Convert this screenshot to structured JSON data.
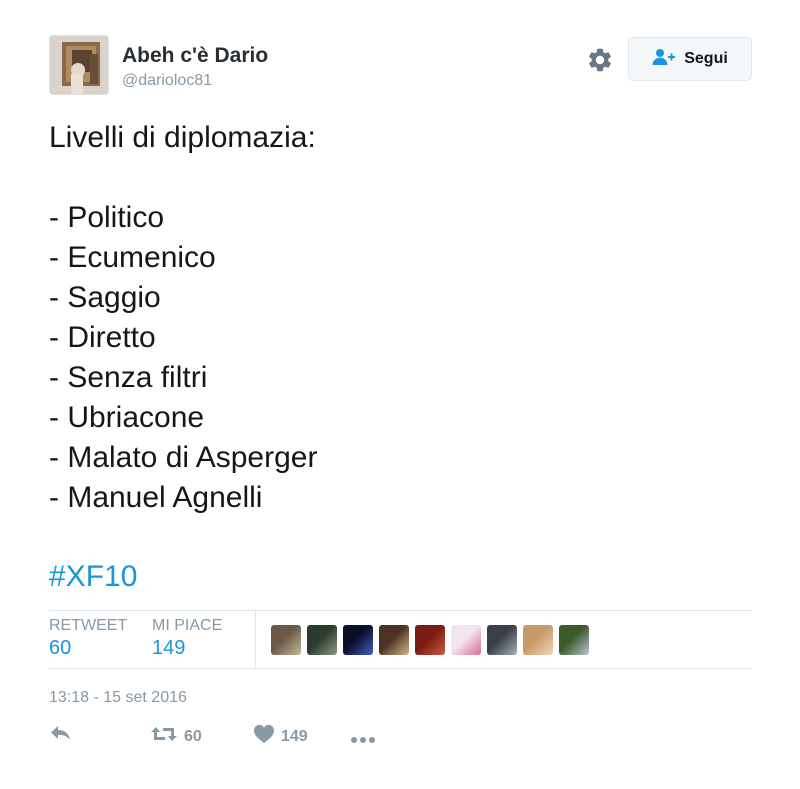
{
  "user": {
    "name": "Abeh c'è Dario",
    "handle": "@darioloc81"
  },
  "header": {
    "follow_label": "Segui"
  },
  "tweet": {
    "heading": "Livelli di diplomazia:",
    "items": [
      "- Politico",
      "- Ecumenico",
      "- Saggio",
      "- Diretto",
      "- Senza filtri",
      "- Ubriacone",
      "- Malato di Asperger",
      "- Manuel Agnelli"
    ],
    "hashtag": "#XF10"
  },
  "stats": {
    "retweet_label": "RETWEET",
    "retweet_count": "60",
    "like_label": "MI PIACE",
    "like_count": "149"
  },
  "likers": [
    {
      "colors": [
        "#6b5a4a",
        "#c9b89e"
      ]
    },
    {
      "colors": [
        "#2d3a2e",
        "#8a9a7e"
      ]
    },
    {
      "colors": [
        "#0b0f2a",
        "#4a5cc8"
      ]
    },
    {
      "colors": [
        "#4a3324",
        "#d8b48c"
      ]
    },
    {
      "colors": [
        "#7a1c14",
        "#c85a3c"
      ]
    },
    {
      "colors": [
        "#f2e6ee",
        "#d86a9a"
      ]
    },
    {
      "colors": [
        "#3a4048",
        "#a8b0b8"
      ]
    },
    {
      "colors": [
        "#c89a6a",
        "#f0d8b8"
      ]
    },
    {
      "colors": [
        "#3c5a2a",
        "#b8c8d8"
      ]
    }
  ],
  "timestamp": "13:18 - 15 set 2016",
  "actions": {
    "retweet_count": "60",
    "like_count": "149"
  },
  "icons": {
    "gear": "gear-icon",
    "follow": "add-user-icon",
    "reply": "reply-icon",
    "retweet": "retweet-icon",
    "like": "heart-icon",
    "more": "more-icon"
  },
  "colors": {
    "link": "#1b95e0",
    "text": "#14171a",
    "muted": "#8899a6",
    "border": "#e1e8ed"
  }
}
